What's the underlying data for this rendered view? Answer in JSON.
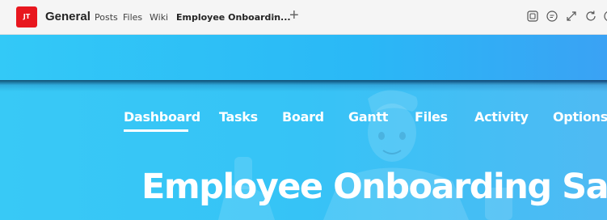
{
  "header": {
    "avatar_initials": "JT",
    "channel_title": "General",
    "tabs": [
      {
        "label": "Posts"
      },
      {
        "label": "Files"
      },
      {
        "label": "Wiki"
      },
      {
        "label": "Employee Onboardin..."
      }
    ],
    "active_tab_index": 3,
    "tools": [
      "popout-chat-icon",
      "conversation-icon",
      "expand-icon",
      "refresh-icon"
    ]
  },
  "app": {
    "nav": [
      {
        "label": "Dashboard"
      },
      {
        "label": "Tasks"
      },
      {
        "label": "Board"
      },
      {
        "label": "Gantt"
      },
      {
        "label": "Files"
      },
      {
        "label": "Activity"
      },
      {
        "label": "Options"
      }
    ],
    "active_nav_index": 0,
    "hero_title": "Employee Onboarding Sample"
  },
  "colors": {
    "avatar": "#e8171e",
    "banner_blue": "#33c9f7",
    "banner_blue_right": "#3aa2f4"
  }
}
